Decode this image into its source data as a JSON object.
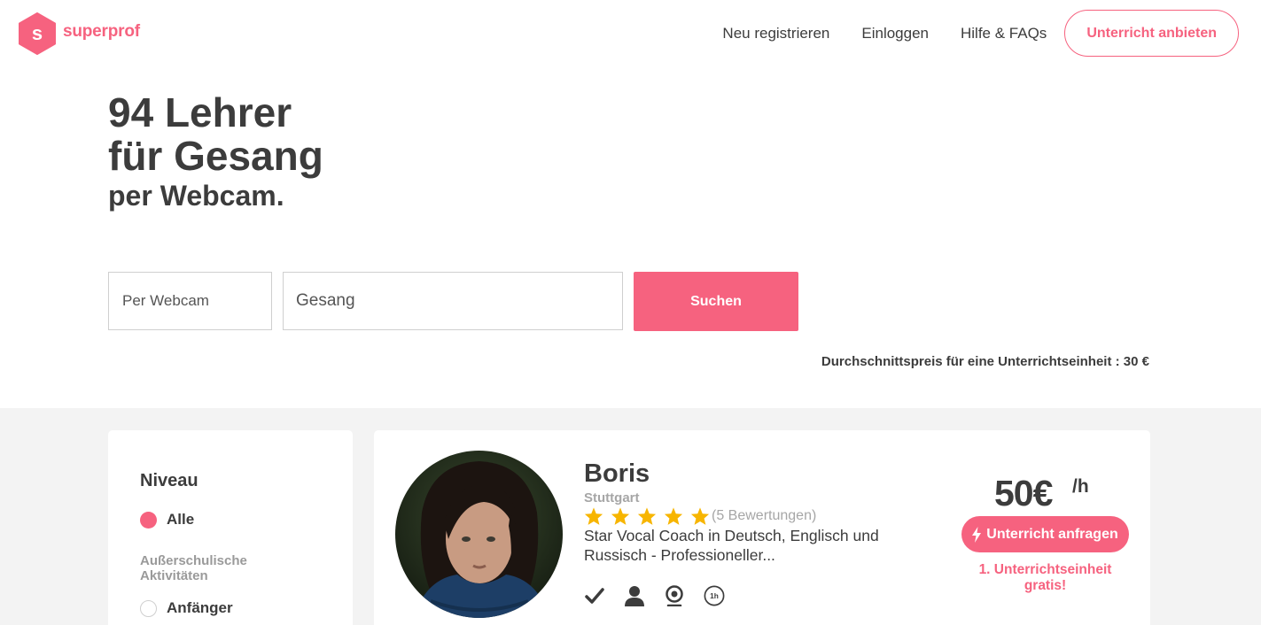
{
  "brand": {
    "logo_letter": "s",
    "name": "superprof",
    "accent": "#f6627f"
  },
  "nav": {
    "register": "Neu registrieren",
    "login": "Einloggen",
    "help": "Hilfe & FAQs",
    "cta": "Unterricht anbieten"
  },
  "hero": {
    "line1": "94 Lehrer",
    "line2": "für Gesang",
    "line3": "per Webcam."
  },
  "search": {
    "mode_value": "Per Webcam",
    "subject_value": "Gesang",
    "button": "Suchen"
  },
  "avg_price": "Durchschnittspreis für eine Unterrichtseinheit : 30 €",
  "filters": {
    "title": "Niveau",
    "options": [
      {
        "label": "Alle",
        "selected": true
      },
      {
        "label": "Anfänger",
        "selected": false
      }
    ],
    "subheading": "Außerschulische Aktivitäten"
  },
  "tutor": {
    "name": "Boris",
    "city": "Stuttgart",
    "rating": 5,
    "reviews": "(5 Bewertungen)",
    "description": "Star Vocal Coach in Deutsch, Englisch und Russisch - Professioneller...",
    "badges": [
      "check-icon",
      "user-icon",
      "webcam-icon",
      "one-hour-icon"
    ],
    "badge_1h": "1h",
    "price": "50€",
    "price_unit": "/h",
    "request_button": "Unterricht anfragen",
    "free_lesson": "1. Unterrichtseinheit gratis!",
    "star_color": "#f7b500"
  }
}
